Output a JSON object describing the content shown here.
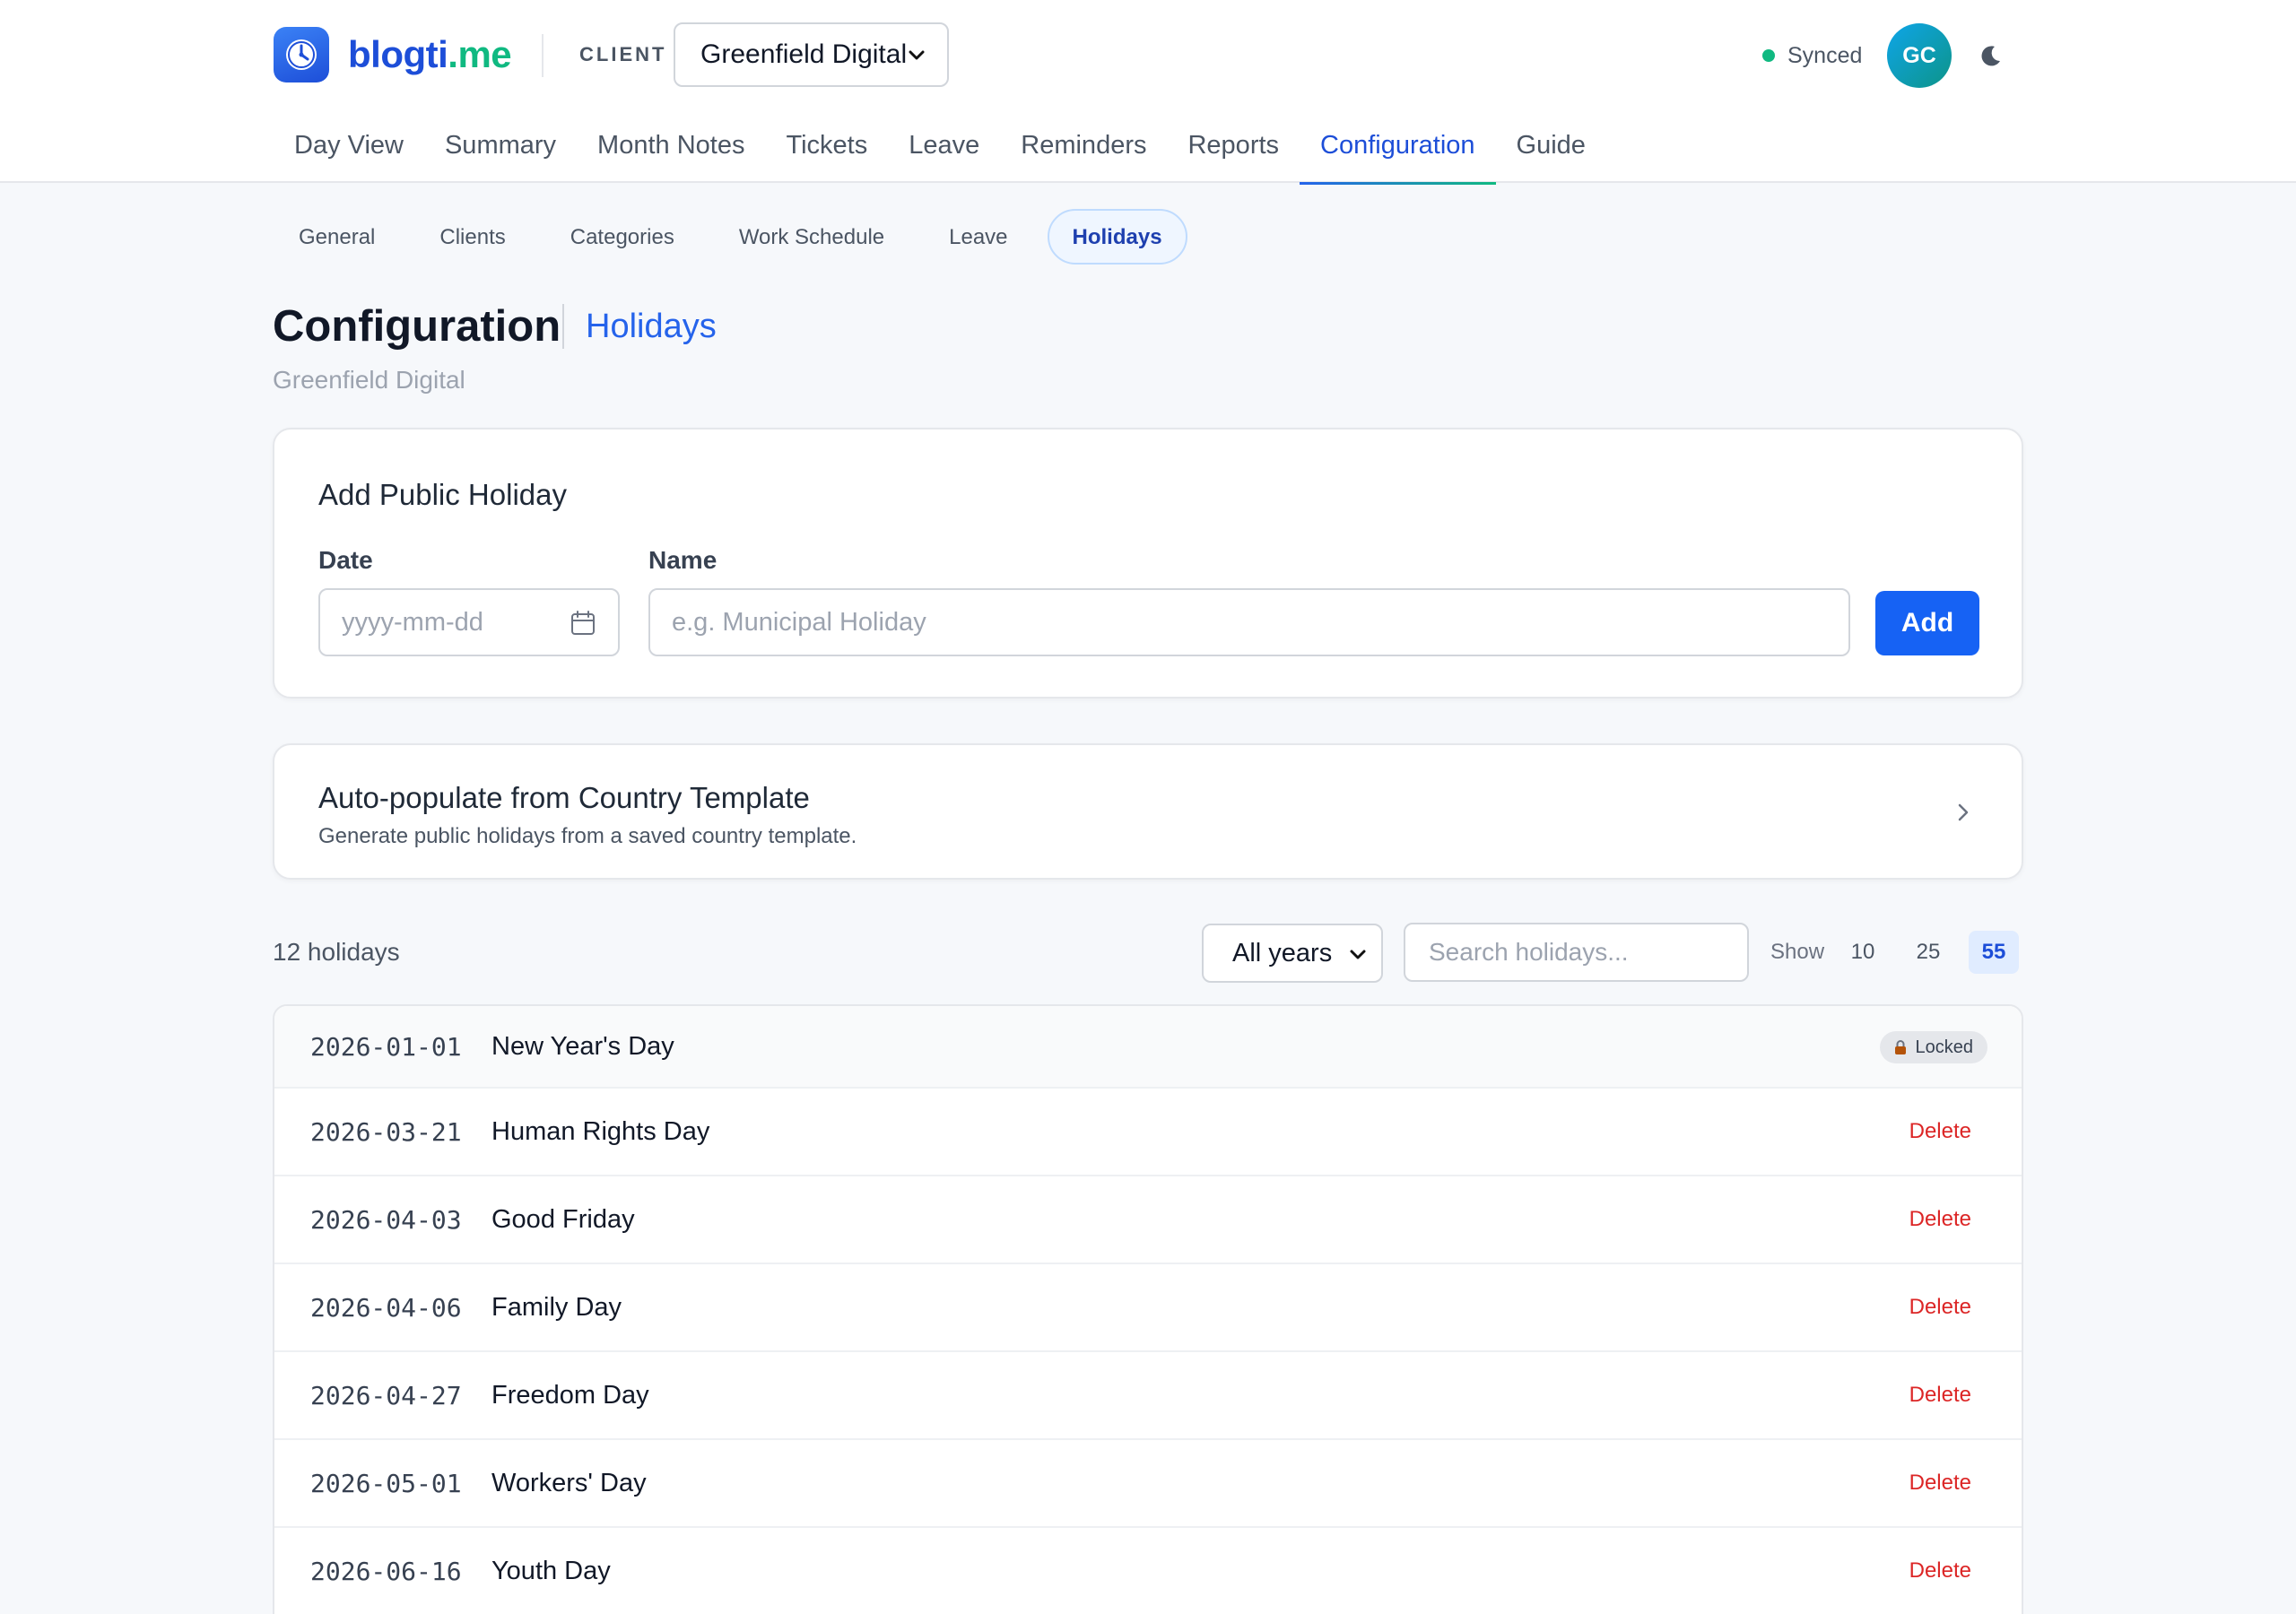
{
  "brand": {
    "name_part1": "blogti",
    "name_part2": ".me"
  },
  "header": {
    "client_label": "CLIENT",
    "client_selected": "Greenfield Digital",
    "sync_status": "Synced",
    "avatar_initials": "GC"
  },
  "nav": {
    "items": [
      {
        "label": "Day View"
      },
      {
        "label": "Summary"
      },
      {
        "label": "Month Notes"
      },
      {
        "label": "Tickets"
      },
      {
        "label": "Leave"
      },
      {
        "label": "Reminders"
      },
      {
        "label": "Reports"
      },
      {
        "label": "Configuration"
      },
      {
        "label": "Guide"
      }
    ],
    "active": "Configuration"
  },
  "subtabs": {
    "items": [
      {
        "label": "General"
      },
      {
        "label": "Clients"
      },
      {
        "label": "Categories"
      },
      {
        "label": "Work Schedule"
      },
      {
        "label": "Leave"
      },
      {
        "label": "Holidays"
      }
    ],
    "active": "Holidays"
  },
  "page": {
    "title": "Configuration",
    "section": "Holidays",
    "subtitle": "Greenfield Digital"
  },
  "add_holiday": {
    "title": "Add Public Holiday",
    "date_label": "Date",
    "date_placeholder": "yyyy-mm-dd",
    "name_label": "Name",
    "name_placeholder": "e.g. Municipal Holiday",
    "add_button": "Add"
  },
  "auto_populate": {
    "title": "Auto-populate from Country Template",
    "description": "Generate public holidays from a saved country template."
  },
  "toolbar": {
    "count": "12 holidays",
    "year_filter": "All years",
    "search_placeholder": "Search holidays...",
    "show_label": "Show",
    "page_sizes": [
      "10",
      "25",
      "55"
    ],
    "active_page_size": "55"
  },
  "holidays": [
    {
      "date": "2026-01-01",
      "name": "New Year's Day",
      "action": "Locked"
    },
    {
      "date": "2026-03-21",
      "name": "Human Rights Day",
      "action": "Delete"
    },
    {
      "date": "2026-04-03",
      "name": "Good Friday",
      "action": "Delete"
    },
    {
      "date": "2026-04-06",
      "name": "Family Day",
      "action": "Delete"
    },
    {
      "date": "2026-04-27",
      "name": "Freedom Day",
      "action": "Delete"
    },
    {
      "date": "2026-05-01",
      "name": "Workers' Day",
      "action": "Delete"
    },
    {
      "date": "2026-06-16",
      "name": "Youth Day",
      "action": "Delete"
    }
  ],
  "colors": {
    "primary": "#1662f4",
    "brand_blue": "#1d4ed8",
    "brand_green": "#10b981",
    "danger": "#dc2626",
    "background": "#f6f8fb"
  }
}
